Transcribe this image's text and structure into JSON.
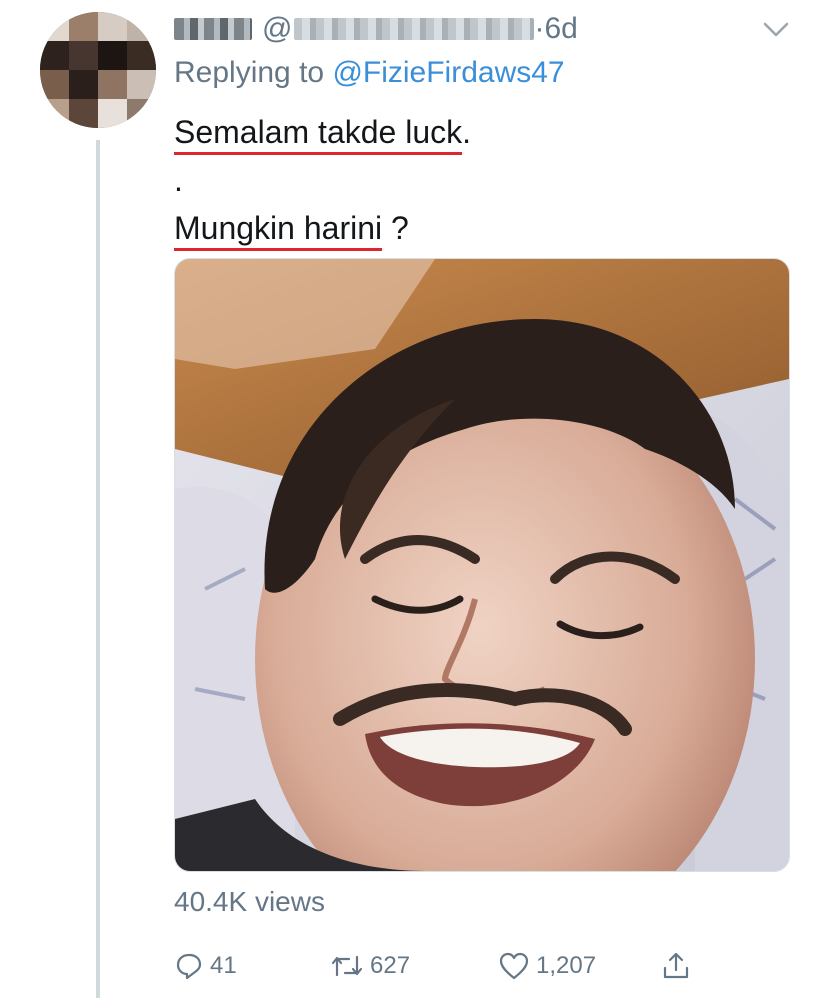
{
  "tweet": {
    "timestamp": "6d",
    "at_sign": "@",
    "dot": "·",
    "reply_prefix": "Replying to ",
    "reply_mention": "@FizieFirdaws47",
    "text_lines": [
      "Semalam takde luck.",
      ".",
      "Mungkin harini ?"
    ],
    "text_parts": {
      "line1_underlined": "Semalam takde luck",
      "line1_rest": ".",
      "line2": ".",
      "line3_underlined": "Mungkin harini",
      "line3_rest": " ?"
    },
    "views": "40.4K views",
    "replies": "41",
    "retweets": "627",
    "likes": "1,207"
  },
  "icons": {
    "caret": "chevron-down-icon",
    "reply": "comment-icon",
    "retweet": "retweet-icon",
    "like": "heart-icon",
    "share": "share-icon"
  },
  "colors": {
    "mention": "#3a8fd8",
    "muted": "#657786",
    "underline": "#e0242f",
    "text": "#14171a"
  }
}
